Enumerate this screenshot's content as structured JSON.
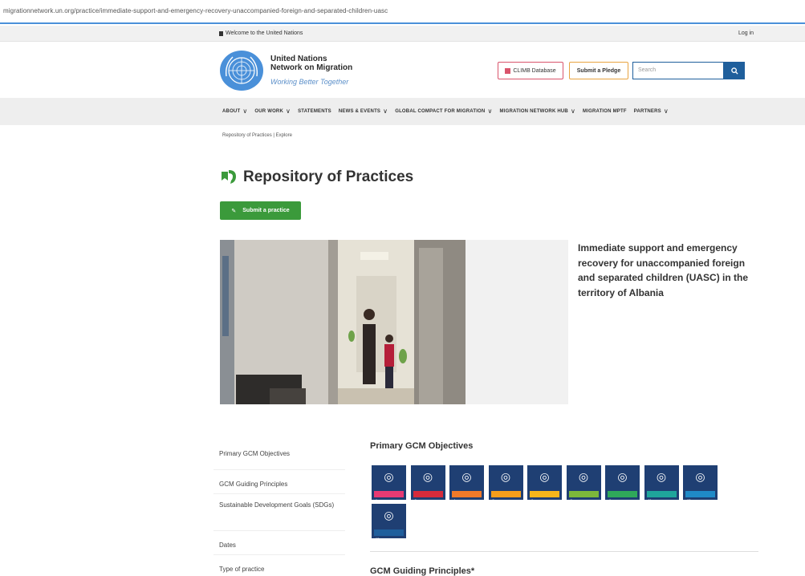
{
  "browser": {
    "url": "migrationnetwork.un.org/practice/immediate-support-and-emergency-recovery-unaccompanied-foreign-and-separated-children-uasc"
  },
  "topbar": {
    "welcome": "Welcome to the United Nations",
    "login": "Log in"
  },
  "header": {
    "org_line1": "United Nations",
    "org_line2": "Network on Migration",
    "tagline": "Working Better Together",
    "climb_button": "CLIMB Database",
    "pledge_button": "Submit a Pledge",
    "search_placeholder": "Search"
  },
  "nav": {
    "items": [
      {
        "label": "ABOUT",
        "dropdown": true
      },
      {
        "label": "OUR WORK",
        "dropdown": true
      },
      {
        "label": "STATEMENTS",
        "dropdown": false
      },
      {
        "label": "NEWS & EVENTS",
        "dropdown": true
      },
      {
        "label": "GLOBAL COMPACT FOR MIGRATION",
        "dropdown": true
      },
      {
        "label": "MIGRATION NETWORK HUB",
        "dropdown": true
      },
      {
        "label": "MIGRATION MPTF",
        "dropdown": false
      },
      {
        "label": "PARTNERS",
        "dropdown": true
      }
    ]
  },
  "breadcrumb": "Repository of Practices | Explore",
  "page": {
    "title": "Repository of Practices",
    "submit_button": "Submit a practice",
    "hero_caption": "Immediate support and emergency recovery for unaccompanied foreign and separated children (UASC) in the territory of Albania"
  },
  "sidebar": {
    "items": [
      "Primary GCM Objectives",
      "GCM Guiding Principles",
      "Sustainable Development Goals (SDGs)",
      "Dates",
      "Type of practice"
    ]
  },
  "objectives": {
    "title": "Primary GCM Objectives",
    "tiles": [
      {
        "number": "1",
        "color": "#1f3f73",
        "stripe": "#e83a73"
      },
      {
        "number": "2",
        "color": "#1f3f73",
        "stripe": "#d62b3b"
      },
      {
        "number": "4",
        "color": "#1f3f73",
        "stripe": "#f07a2a"
      },
      {
        "number": "5",
        "color": "#1f3f73",
        "stripe": "#f59e1b"
      },
      {
        "number": "6",
        "color": "#1f3f73",
        "stripe": "#f5b51b"
      },
      {
        "number": "8",
        "color": "#1f3f73",
        "stripe": "#7cb83b"
      },
      {
        "number": "9",
        "color": "#1f3f73",
        "stripe": "#2fa85a"
      },
      {
        "number": "11",
        "color": "#1f3f73",
        "stripe": "#1fa59b"
      },
      {
        "number": "12",
        "color": "#1f3f73",
        "stripe": "#1f8ac7"
      },
      {
        "number": "13",
        "color": "#1f3f73",
        "stripe": "#1f5f9c"
      }
    ]
  },
  "principles": {
    "title": "GCM Guiding Principles*"
  },
  "colors": {
    "accent_blue": "#1f5f9c",
    "green": "#3b9a3b",
    "pink": "#d9546c",
    "orange": "#e8a441"
  }
}
